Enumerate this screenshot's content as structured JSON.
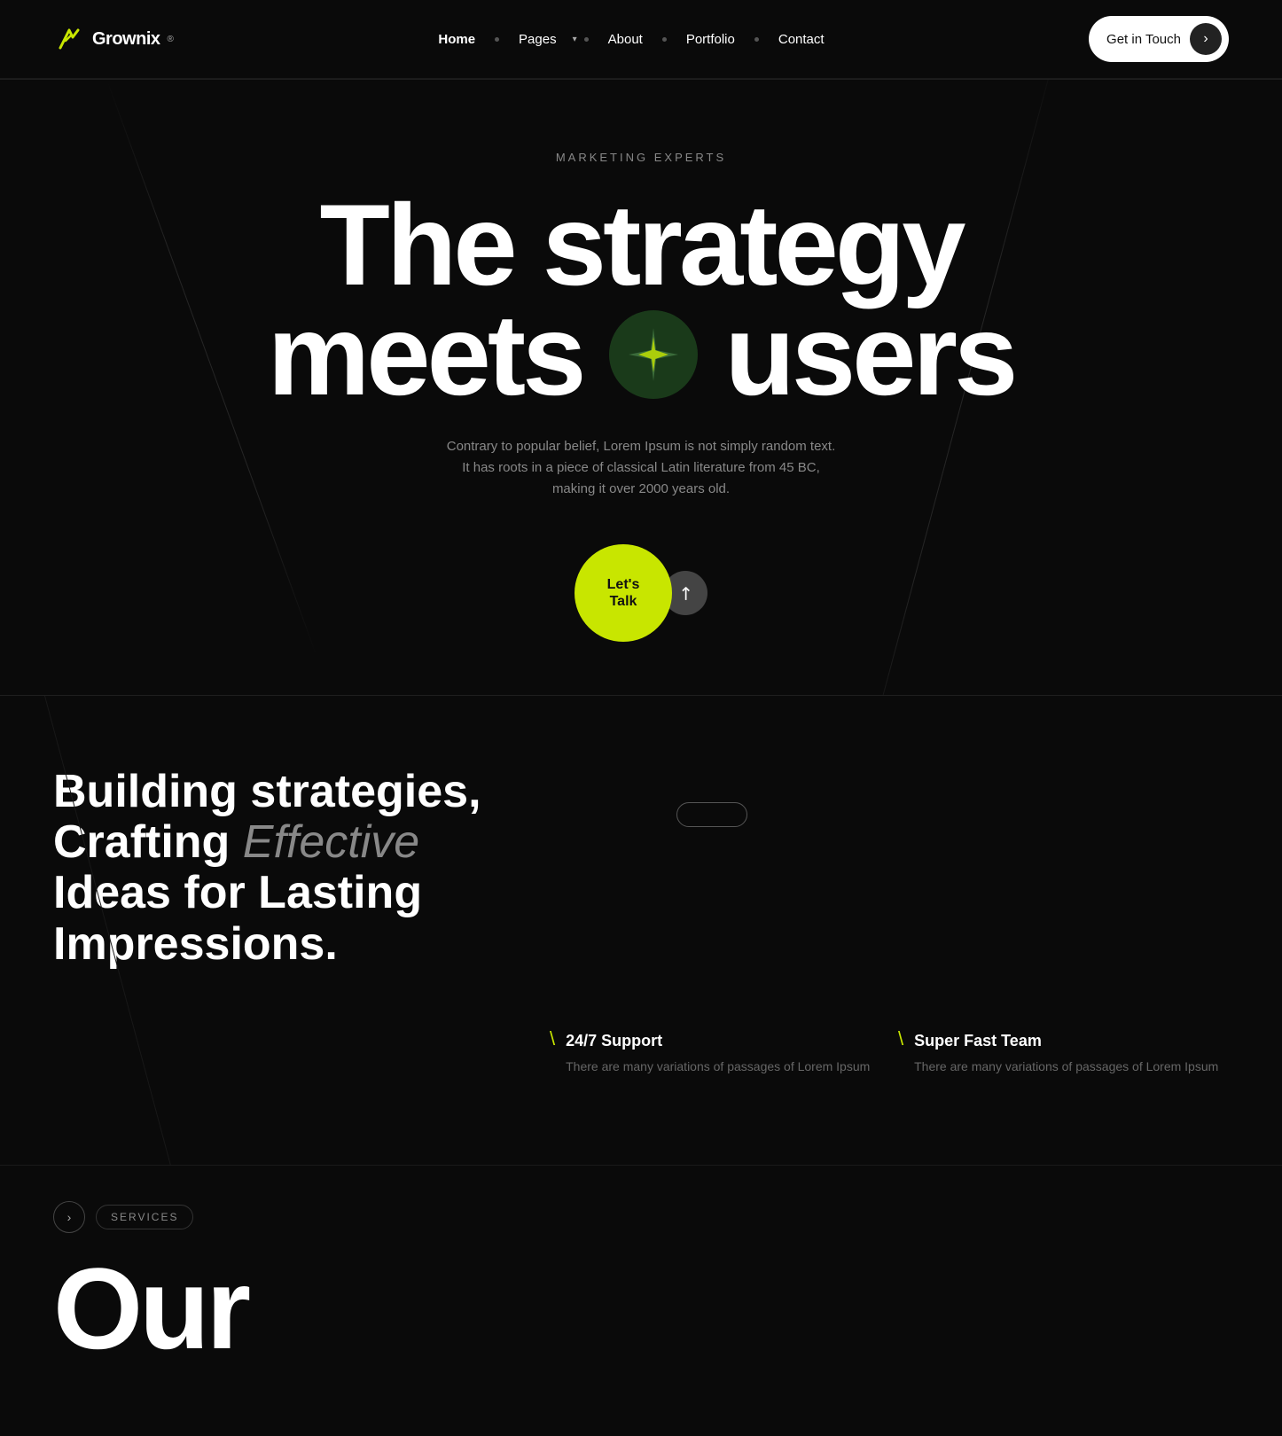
{
  "logo": {
    "text": "Grownix",
    "sup": "®"
  },
  "navbar": {
    "links": [
      {
        "label": "Home",
        "active": true,
        "hasDropdown": false
      },
      {
        "label": "Pages",
        "active": false,
        "hasDropdown": true
      },
      {
        "label": "About",
        "active": false,
        "hasDropdown": false
      },
      {
        "label": "Portfolio",
        "active": false,
        "hasDropdown": false
      },
      {
        "label": "Contact",
        "active": false,
        "hasDropdown": false
      }
    ],
    "cta_label": "Get in Touch"
  },
  "hero": {
    "subtitle": "MARKETING EXPERTS",
    "title_line1": "The strategy",
    "title_line2_start": "meets",
    "title_line2_end": "users",
    "description": "Contrary to popular belief, Lorem Ipsum is not simply random text. It has roots in a piece of classical Latin literature from 45 BC, making it over 2000 years old.",
    "cta_label": "Let's\nTalk"
  },
  "strategies": {
    "title_line1": "Building strategies,",
    "title_line2_start": "Crafting ",
    "title_highlight": "Effective",
    "title_line3": "Ideas for Lasting",
    "title_line4": "Impressions."
  },
  "features": [
    {
      "title": "24/7 Support",
      "description": "There are many variations of passages of Lorem Ipsum"
    },
    {
      "title": "Super Fast Team",
      "description": "There are many variations of passages of Lorem Ipsum"
    }
  ],
  "services": {
    "tag_label": "SERVICES",
    "heading": "Our"
  }
}
